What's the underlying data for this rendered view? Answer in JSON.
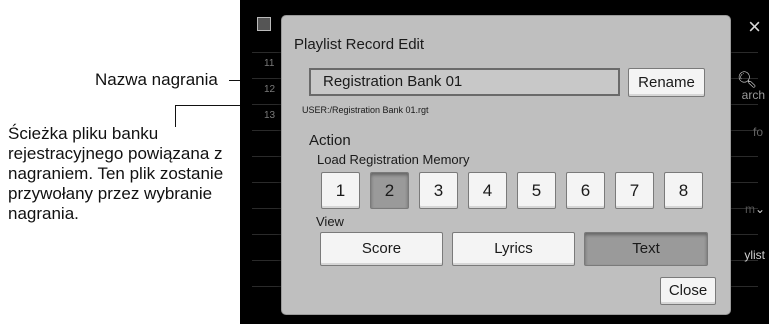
{
  "annotations": {
    "recording_name": "Nazwa nagrania",
    "bank_path": "Ścieżka pliku banku rejestracyjnego powiązana z nagraniem. Ten plik zostanie przywołany przez wybranie nagrania."
  },
  "background": {
    "row_numbers": [
      "11",
      "12",
      "13"
    ],
    "side_items": [
      "arch",
      "fo",
      "m",
      "ylist"
    ],
    "close_glyph": "×"
  },
  "dialog": {
    "title": "Playlist Record Edit",
    "name_value": "Registration Bank 01",
    "rename_label": "Rename",
    "path": "USER:/Registration Bank 01.rgt",
    "action_label": "Action",
    "load_memory_label": "Load Registration Memory",
    "memory_buttons": [
      "1",
      "2",
      "3",
      "4",
      "5",
      "6",
      "7",
      "8"
    ],
    "selected_memory": "2",
    "view_label": "View",
    "view_buttons": [
      "Score",
      "Lyrics",
      "Text"
    ],
    "selected_view": "Text",
    "close_label": "Close"
  }
}
